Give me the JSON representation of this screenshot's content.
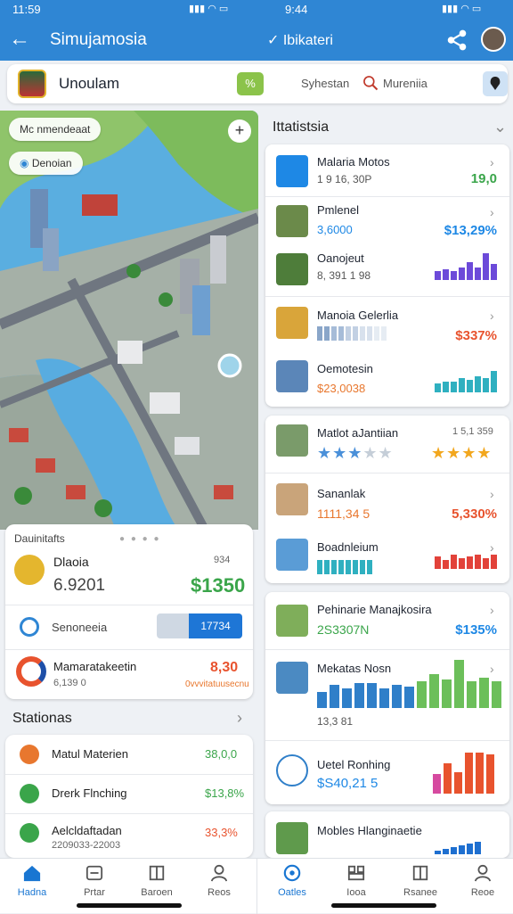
{
  "status": {
    "time_left": "11:59",
    "time_right": "9:44"
  },
  "appbar": {
    "title": "Simujamosia",
    "secondary_title": "Ibikateri",
    "back_icon": "back-arrow-icon",
    "share_icon": "share-icon"
  },
  "search": {
    "brand": "Unoulam",
    "quick_label": "%",
    "filter_label": "Syhestan",
    "placeholder": "Mureniia"
  },
  "map": {
    "chip_top": "Mc nmendeaat",
    "chip_location": "Denoian"
  },
  "left_card": {
    "header": "Dauinitafts",
    "feature_title": "Dlaoia",
    "feature_meta": "6.9201",
    "feature_badge": "934",
    "feature_value": "$1350",
    "toggle_label": "Senoneeia",
    "toggle_value": "17734",
    "stat_title": "Mamaratakeetin",
    "stat_meta": "6,139 0",
    "stat_value": "8,30",
    "stat_sub": "0vvvitatuusecnu"
  },
  "stations": {
    "heading": "Stationas",
    "items": [
      {
        "label": "Matul  Materien",
        "value": "38,0,0",
        "color": "#e8772e"
      },
      {
        "label": "Drerk  Flnching",
        "value": "$13,8%",
        "color": "#3aa54a"
      },
      {
        "label": "Aelcldaftadan",
        "sub": "2209033-22003",
        "value": "33,3%",
        "color": "#3aa54a"
      }
    ]
  },
  "right": {
    "heading": "Ittatistsia",
    "card1": [
      {
        "title": "Malaria Motos",
        "sub": "1 9 16, 30P",
        "value": "19,0",
        "value_color": "#3aa54a"
      },
      {
        "title": "Pmlenel",
        "sub": "3,6000",
        "value": "$13,29%",
        "value_color": "#1e88e5"
      },
      {
        "title": "Oanojeut",
        "sub": "8, 391 1 98"
      },
      {
        "title": "Manoia  Gelerlia",
        "value": "$337%",
        "value_color": "#e8532e"
      },
      {
        "title": "Oemotesin",
        "sub": "$23,0038"
      }
    ],
    "card2": [
      {
        "title": "Matlot  aJantiian",
        "sub": "1 5,1 359"
      },
      {
        "title": "Sananlak",
        "sub": "1111,34 5",
        "value": "5,330%",
        "value_color": "#e8532e"
      },
      {
        "title": "Boadnleium"
      }
    ],
    "card3": [
      {
        "title": "Pehinarie  Manajkosira",
        "sub": "2S3307N",
        "value": "$135%",
        "value_color": "#1e88e5"
      },
      {
        "title": "Mekatas  Nosn",
        "sub": "13,3 81"
      },
      {
        "title": "Uetel  Ronhing",
        "sub": "$S40,21 5"
      }
    ],
    "card4": {
      "title": "Mobles  Hlanginaetie"
    }
  },
  "tabs_left": [
    "Hadna",
    "Prtar",
    "Baroen",
    "Reos"
  ],
  "tabs_right": [
    "Oatles",
    "Iooa",
    "Rsanee",
    "Reoe"
  ]
}
